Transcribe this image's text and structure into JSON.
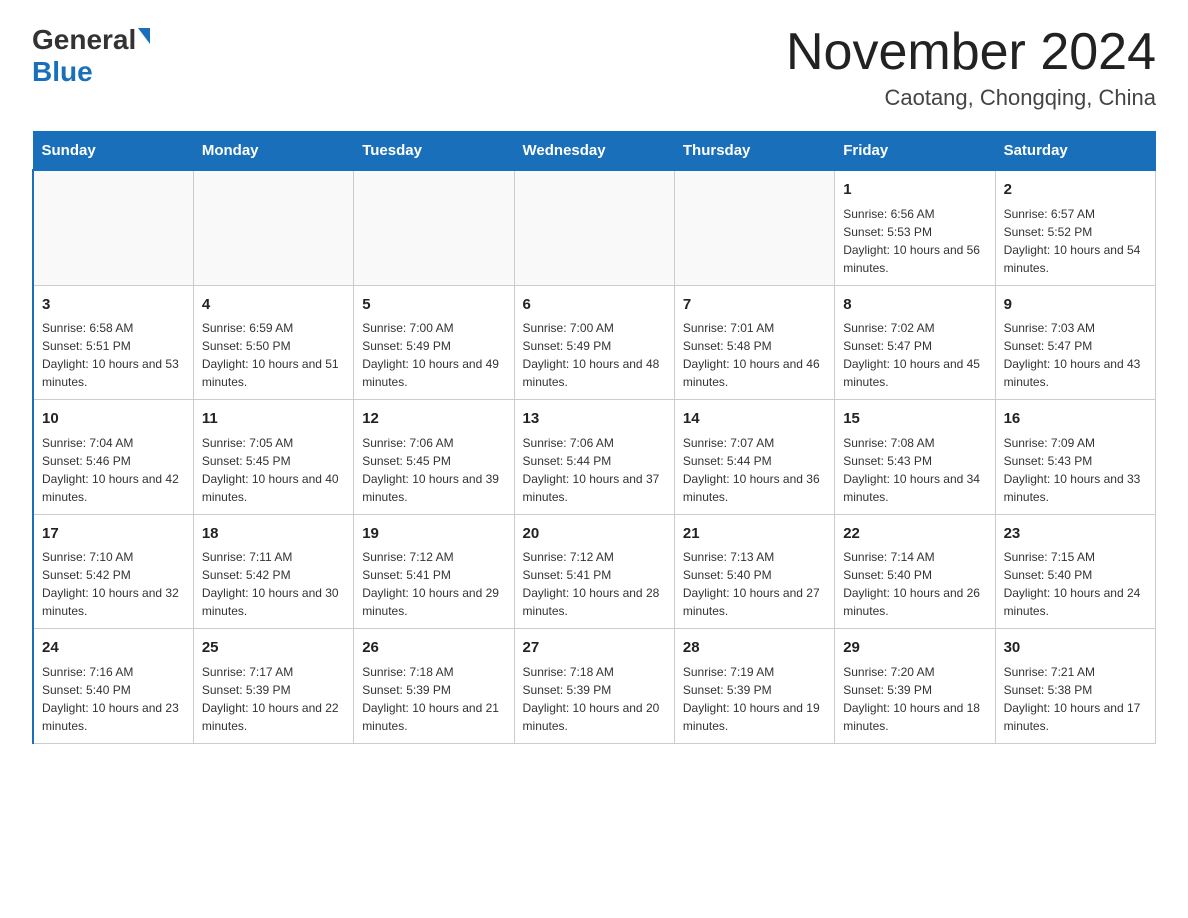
{
  "header": {
    "logo_general": "General",
    "logo_blue": "Blue",
    "month_title": "November 2024",
    "location": "Caotang, Chongqing, China"
  },
  "days_of_week": [
    "Sunday",
    "Monday",
    "Tuesday",
    "Wednesday",
    "Thursday",
    "Friday",
    "Saturday"
  ],
  "weeks": [
    [
      {
        "day": "",
        "info": ""
      },
      {
        "day": "",
        "info": ""
      },
      {
        "day": "",
        "info": ""
      },
      {
        "day": "",
        "info": ""
      },
      {
        "day": "",
        "info": ""
      },
      {
        "day": "1",
        "info": "Sunrise: 6:56 AM\nSunset: 5:53 PM\nDaylight: 10 hours and 56 minutes."
      },
      {
        "day": "2",
        "info": "Sunrise: 6:57 AM\nSunset: 5:52 PM\nDaylight: 10 hours and 54 minutes."
      }
    ],
    [
      {
        "day": "3",
        "info": "Sunrise: 6:58 AM\nSunset: 5:51 PM\nDaylight: 10 hours and 53 minutes."
      },
      {
        "day": "4",
        "info": "Sunrise: 6:59 AM\nSunset: 5:50 PM\nDaylight: 10 hours and 51 minutes."
      },
      {
        "day": "5",
        "info": "Sunrise: 7:00 AM\nSunset: 5:49 PM\nDaylight: 10 hours and 49 minutes."
      },
      {
        "day": "6",
        "info": "Sunrise: 7:00 AM\nSunset: 5:49 PM\nDaylight: 10 hours and 48 minutes."
      },
      {
        "day": "7",
        "info": "Sunrise: 7:01 AM\nSunset: 5:48 PM\nDaylight: 10 hours and 46 minutes."
      },
      {
        "day": "8",
        "info": "Sunrise: 7:02 AM\nSunset: 5:47 PM\nDaylight: 10 hours and 45 minutes."
      },
      {
        "day": "9",
        "info": "Sunrise: 7:03 AM\nSunset: 5:47 PM\nDaylight: 10 hours and 43 minutes."
      }
    ],
    [
      {
        "day": "10",
        "info": "Sunrise: 7:04 AM\nSunset: 5:46 PM\nDaylight: 10 hours and 42 minutes."
      },
      {
        "day": "11",
        "info": "Sunrise: 7:05 AM\nSunset: 5:45 PM\nDaylight: 10 hours and 40 minutes."
      },
      {
        "day": "12",
        "info": "Sunrise: 7:06 AM\nSunset: 5:45 PM\nDaylight: 10 hours and 39 minutes."
      },
      {
        "day": "13",
        "info": "Sunrise: 7:06 AM\nSunset: 5:44 PM\nDaylight: 10 hours and 37 minutes."
      },
      {
        "day": "14",
        "info": "Sunrise: 7:07 AM\nSunset: 5:44 PM\nDaylight: 10 hours and 36 minutes."
      },
      {
        "day": "15",
        "info": "Sunrise: 7:08 AM\nSunset: 5:43 PM\nDaylight: 10 hours and 34 minutes."
      },
      {
        "day": "16",
        "info": "Sunrise: 7:09 AM\nSunset: 5:43 PM\nDaylight: 10 hours and 33 minutes."
      }
    ],
    [
      {
        "day": "17",
        "info": "Sunrise: 7:10 AM\nSunset: 5:42 PM\nDaylight: 10 hours and 32 minutes."
      },
      {
        "day": "18",
        "info": "Sunrise: 7:11 AM\nSunset: 5:42 PM\nDaylight: 10 hours and 30 minutes."
      },
      {
        "day": "19",
        "info": "Sunrise: 7:12 AM\nSunset: 5:41 PM\nDaylight: 10 hours and 29 minutes."
      },
      {
        "day": "20",
        "info": "Sunrise: 7:12 AM\nSunset: 5:41 PM\nDaylight: 10 hours and 28 minutes."
      },
      {
        "day": "21",
        "info": "Sunrise: 7:13 AM\nSunset: 5:40 PM\nDaylight: 10 hours and 27 minutes."
      },
      {
        "day": "22",
        "info": "Sunrise: 7:14 AM\nSunset: 5:40 PM\nDaylight: 10 hours and 26 minutes."
      },
      {
        "day": "23",
        "info": "Sunrise: 7:15 AM\nSunset: 5:40 PM\nDaylight: 10 hours and 24 minutes."
      }
    ],
    [
      {
        "day": "24",
        "info": "Sunrise: 7:16 AM\nSunset: 5:40 PM\nDaylight: 10 hours and 23 minutes."
      },
      {
        "day": "25",
        "info": "Sunrise: 7:17 AM\nSunset: 5:39 PM\nDaylight: 10 hours and 22 minutes."
      },
      {
        "day": "26",
        "info": "Sunrise: 7:18 AM\nSunset: 5:39 PM\nDaylight: 10 hours and 21 minutes."
      },
      {
        "day": "27",
        "info": "Sunrise: 7:18 AM\nSunset: 5:39 PM\nDaylight: 10 hours and 20 minutes."
      },
      {
        "day": "28",
        "info": "Sunrise: 7:19 AM\nSunset: 5:39 PM\nDaylight: 10 hours and 19 minutes."
      },
      {
        "day": "29",
        "info": "Sunrise: 7:20 AM\nSunset: 5:39 PM\nDaylight: 10 hours and 18 minutes."
      },
      {
        "day": "30",
        "info": "Sunrise: 7:21 AM\nSunset: 5:38 PM\nDaylight: 10 hours and 17 minutes."
      }
    ]
  ]
}
